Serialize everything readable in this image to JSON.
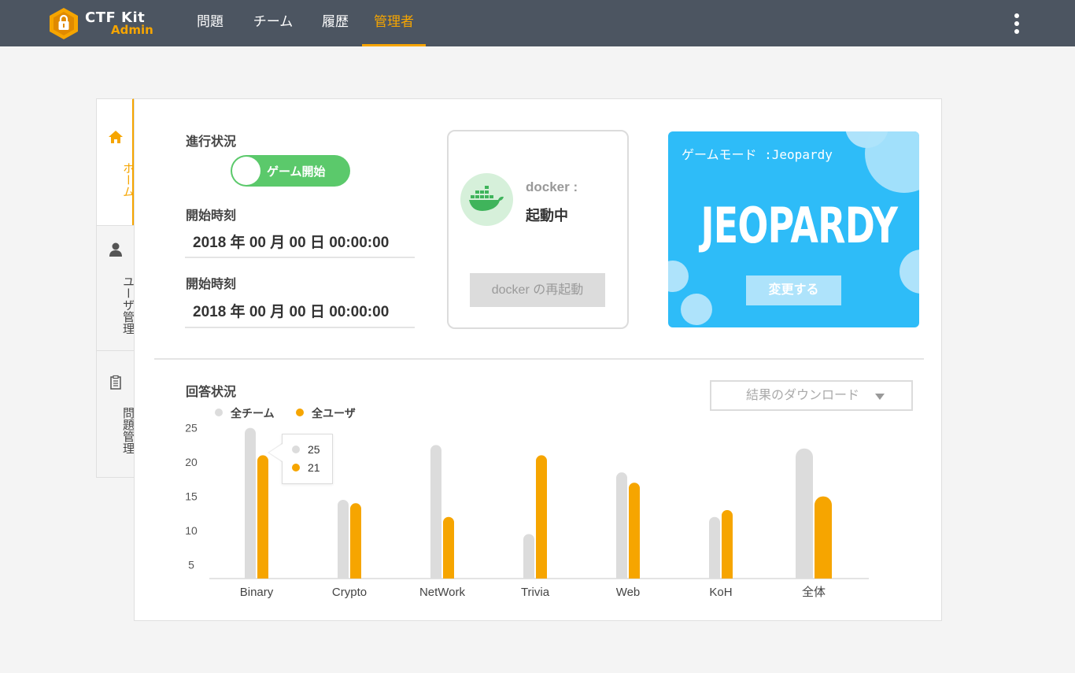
{
  "app": {
    "logo_title": "CTF Kit",
    "logo_sub": "Admin"
  },
  "nav": {
    "items": [
      {
        "label": "問題",
        "active": false
      },
      {
        "label": "チーム",
        "active": false
      },
      {
        "label": "履歴",
        "active": false
      },
      {
        "label": "管理者",
        "active": true
      }
    ],
    "menu_icon": "kebab-icon"
  },
  "sidebar": {
    "items": [
      {
        "label": "ホーム",
        "icon": "home-icon",
        "active": true
      },
      {
        "label": "ユーザ管理",
        "icon": "user-icon",
        "active": false
      },
      {
        "label": "問題管理",
        "icon": "clipboard-icon",
        "active": false
      }
    ]
  },
  "status": {
    "progress_label": "進行状況",
    "toggle_label": "ゲーム開始",
    "start_label_1": "開始時刻",
    "start_value_1": "2018 年 00 月 00 日 00:00:00",
    "start_label_2": "開始時刻",
    "start_value_2": "2018 年 00 月 00 日 00:00:00"
  },
  "docker": {
    "title": "docker :",
    "status": "起動中",
    "restart_button": "docker の再起動",
    "icon": "docker-whale-icon"
  },
  "game_mode": {
    "label": "ゲームモード :Jeopardy",
    "logo_text": "JEOPARDY",
    "change_button": "変更する"
  },
  "answers": {
    "section_title": "回答状況",
    "download_select": "結果のダウンロード",
    "legend": [
      {
        "label": "全チーム",
        "color": "#dcdcdc"
      },
      {
        "label": "全ユーザ",
        "color": "#f6a500"
      }
    ],
    "tooltip": {
      "team_value": "25",
      "user_value": "21"
    }
  },
  "colors": {
    "accent": "#f6a500",
    "topbar": "#4c5561",
    "team_bar": "#dcdcdc",
    "user_bar": "#f6a500",
    "toggle_on": "#5bc96b",
    "game_blue": "#2ebcf8"
  },
  "chart_data": {
    "type": "bar",
    "categories": [
      "Binary",
      "Crypto",
      "NetWork",
      "Trivia",
      "Web",
      "KoH",
      "全体"
    ],
    "series": [
      {
        "name": "全チーム",
        "values": [
          25,
          14.5,
          22.5,
          9.5,
          18.5,
          12,
          22
        ]
      },
      {
        "name": "全ユーザ",
        "values": [
          21,
          14,
          12,
          21,
          17,
          13,
          15
        ]
      }
    ],
    "y_ticks": [
      5,
      10,
      15,
      20,
      25
    ],
    "ylim": [
      3,
      25
    ],
    "grid": false,
    "legend_position": "top-left"
  }
}
